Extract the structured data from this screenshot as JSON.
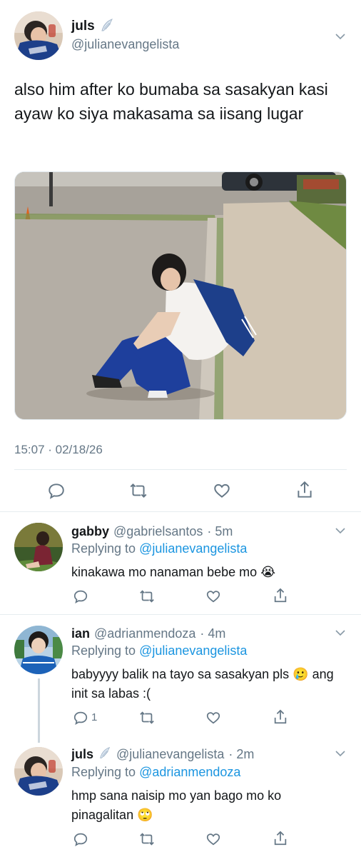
{
  "main_tweet": {
    "display_name": "juls",
    "badge_icon": "wing-emoji-icon",
    "handle": "@julianevangelista",
    "text": "also him after ko bumaba sa sasakyan kasi ayaw ko siya makasama sa iisang lugar",
    "timestamp": "15:07 · 02/18/26",
    "actions": [
      "reply-icon",
      "retweet-icon",
      "like-icon",
      "share-icon"
    ]
  },
  "replies": [
    {
      "display_name": "gabby",
      "handle": "@gabrielsantos",
      "time": "· 5m",
      "replying_label": "Replying to",
      "replying_to": "@julianevangelista",
      "text": "kinakawa mo nanaman bebe mo 😭",
      "reply_count": ""
    },
    {
      "display_name": "ian",
      "handle": "@adrianmendoza",
      "time": "· 4m",
      "replying_label": "Replying to",
      "replying_to": "@julianevangelista",
      "text": "babyyyy balik na tayo sa sasakyan pls 🥲 ang init sa labas :(",
      "reply_count": "1"
    },
    {
      "display_name": "juls",
      "handle": "@julianevangelista",
      "time": "· 2m",
      "replying_label": "Replying to",
      "replying_to": "@adrianmendoza",
      "text": "hmp sana naisip mo yan bago mo ko pinagalitan 🙄",
      "reply_count": ""
    }
  ],
  "colors": {
    "link": "#1b95e0",
    "muted": "#657786",
    "divider": "#e6ecf0",
    "icon": "#657786"
  }
}
